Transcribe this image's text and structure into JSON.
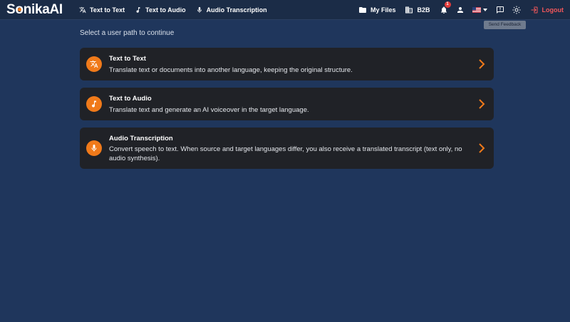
{
  "brand": {
    "name_prefix": "S",
    "name_mid": "onika",
    "name_suffix": "AI",
    "accent": "#f07a1a"
  },
  "nav": {
    "left": [
      {
        "label": "Text to Text",
        "icon": "translate-icon"
      },
      {
        "label": "Text to Audio",
        "icon": "music-note-icon"
      },
      {
        "label": "Audio Transcription",
        "icon": "microphone-icon"
      }
    ],
    "my_files": "My Files",
    "b2b": "B2B",
    "notifications_count": "1",
    "logout": "Logout"
  },
  "tooltip": "Send Feedback",
  "main": {
    "prompt": "Select a user path to continue",
    "cards": [
      {
        "title": "Text to Text",
        "description": "Translate text or documents into another language, keeping the original structure.",
        "icon": "translate-icon"
      },
      {
        "title": "Text to Audio",
        "description": "Translate text and generate an AI voiceover in the target language.",
        "icon": "music-note-icon"
      },
      {
        "title": "Audio Transcription",
        "description": "Convert speech to text. When source and target languages differ, you also receive a translated transcript (text only, no audio synthesis).",
        "icon": "microphone-icon"
      }
    ]
  },
  "colors": {
    "background": "#1f365c",
    "topbar": "#1b2c47",
    "card": "#202227",
    "logout": "#f2575a"
  }
}
